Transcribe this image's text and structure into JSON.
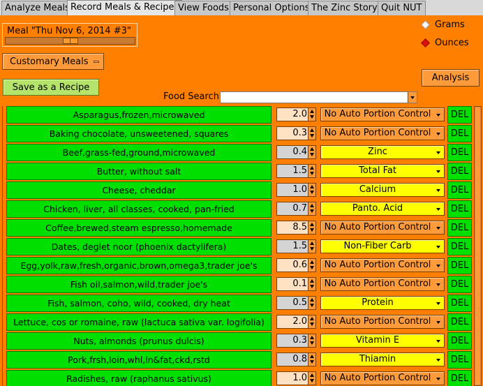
{
  "tabs": [
    {
      "label": "Analyze Meals"
    },
    {
      "label": "Record Meals & Recipes"
    },
    {
      "label": "View Foods"
    },
    {
      "label": "Personal Options"
    },
    {
      "label": "The Zinc Story"
    },
    {
      "label": "Quit NUT"
    }
  ],
  "meal": {
    "title": "Meal \"Thu Nov  6, 2014 #3\"",
    "slider_position": 0.5
  },
  "buttons": {
    "customary": "Customary Meals",
    "save_recipe": "Save as a Recipe",
    "analysis": "Analysis"
  },
  "units": {
    "grams": "Grams",
    "ounces": "Ounces",
    "selected": "Ounces"
  },
  "search": {
    "label": "Food Search",
    "value": ""
  },
  "del_label": "DEL",
  "colors": {
    "panel": "#ff8000",
    "food_green": "#00e000",
    "portion_yellow": "#ffff00"
  },
  "foods": [
    {
      "name": "Asparagus,frozen,microwaved",
      "qty": "2.0",
      "portion": "No Auto Portion Control",
      "auto": false
    },
    {
      "name": "Baking chocolate, unsweetened, squares",
      "qty": "0.3",
      "portion": "No Auto Portion Control",
      "auto": false
    },
    {
      "name": "Beef,grass-fed,ground,microwaved",
      "qty": "0.4",
      "portion": "Zinc",
      "auto": true
    },
    {
      "name": "Butter, without salt",
      "qty": "1.5",
      "portion": "Total Fat",
      "auto": true
    },
    {
      "name": "Cheese, cheddar",
      "qty": "1.0",
      "portion": "Calcium",
      "auto": true
    },
    {
      "name": "Chicken, liver, all classes, cooked, pan-fried",
      "qty": "0.7",
      "portion": "Panto. Acid",
      "auto": true
    },
    {
      "name": "Coffee,brewed,steam espresso,homemade",
      "qty": "8.5",
      "portion": "No Auto Portion Control",
      "auto": false
    },
    {
      "name": "Dates, deglet noor (phoenix dactylifera)",
      "qty": "1.5",
      "portion": "Non-Fiber Carb",
      "auto": true
    },
    {
      "name": "Egg,yolk,raw,fresh,organic,brown,omega3,trader joe's",
      "qty": "0.6",
      "portion": "No Auto Portion Control",
      "auto": false
    },
    {
      "name": "Fish oil,salmon,wild,trader joe's",
      "qty": "0.1",
      "portion": "No Auto Portion Control",
      "auto": false
    },
    {
      "name": "Fish, salmon, coho, wild, cooked, dry heat",
      "qty": "0.5",
      "portion": "Protein",
      "auto": true
    },
    {
      "name": "Lettuce, cos or romaine, raw (lactuca sativa var. logifolia)",
      "qty": "2.0",
      "portion": "No Auto Portion Control",
      "auto": false
    },
    {
      "name": "Nuts, almonds (prunus dulcis)",
      "qty": "0.3",
      "portion": "Vitamin E",
      "auto": true
    },
    {
      "name": "Pork,frsh,loin,whl,ln&fat,ckd,rstd",
      "qty": "0.8",
      "portion": "Thiamin",
      "auto": true
    },
    {
      "name": "Radishes, raw (raphanus sativus)",
      "qty": "1.0",
      "portion": "No Auto Portion Control",
      "auto": false
    }
  ]
}
